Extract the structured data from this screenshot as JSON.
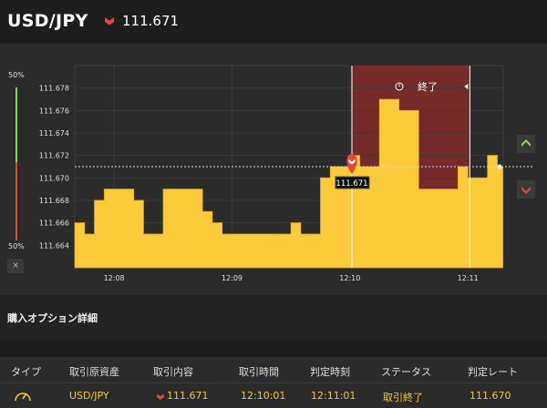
{
  "header": {
    "pair": "USD/JPY",
    "price": "111.671",
    "direction": "down"
  },
  "chart": {
    "percent_top": "50%",
    "percent_bottom": "50%",
    "close_label": "×",
    "end_label": "終了",
    "marker_label": "111.671",
    "y_ticks": [
      "111.678",
      "111.676",
      "111.674",
      "111.672",
      "111.670",
      "111.668",
      "111.666",
      "111.664"
    ],
    "x_ticks": [
      "12:08",
      "12:09",
      "12:10",
      "12:11"
    ],
    "colors": {
      "fill": "#fccb3c",
      "window": "#7a2a2a",
      "down": "#e04a3a",
      "up": "#8fd14f"
    }
  },
  "chart_data": {
    "type": "area",
    "ylim": [
      111.662,
      111.68
    ],
    "x": [
      "12:07:40",
      "12:07:45",
      "12:07:50",
      "12:07:55",
      "12:08:00",
      "12:08:05",
      "12:08:10",
      "12:08:15",
      "12:08:20",
      "12:08:25",
      "12:08:30",
      "12:08:35",
      "12:08:40",
      "12:08:45",
      "12:08:50",
      "12:08:55",
      "12:09:00",
      "12:09:05",
      "12:09:10",
      "12:09:15",
      "12:09:20",
      "12:09:25",
      "12:09:30",
      "12:09:35",
      "12:09:40",
      "12:09:45",
      "12:09:50",
      "12:09:55",
      "12:10:00",
      "12:10:05",
      "12:10:10",
      "12:10:15",
      "12:10:20",
      "12:10:25",
      "12:10:30",
      "12:10:35",
      "12:10:40",
      "12:10:45",
      "12:10:50",
      "12:10:55",
      "12:11:00",
      "12:11:05",
      "12:11:10",
      "12:11:15"
    ],
    "values": [
      111.666,
      111.665,
      111.668,
      111.669,
      111.669,
      111.669,
      111.668,
      111.665,
      111.665,
      111.669,
      111.669,
      111.669,
      111.669,
      111.667,
      111.666,
      111.665,
      111.665,
      111.665,
      111.665,
      111.665,
      111.665,
      111.665,
      111.666,
      111.665,
      111.665,
      111.67,
      111.671,
      111.671,
      111.672,
      111.671,
      111.671,
      111.677,
      111.677,
      111.676,
      111.676,
      111.669,
      111.669,
      111.669,
      111.669,
      111.671,
      111.67,
      111.67,
      111.672,
      111.671
    ],
    "grid": true
  },
  "section": {
    "title": "購入オプション詳細"
  },
  "table": {
    "headers": [
      "タイプ",
      "取引原資産",
      "取引内容",
      "取引時間",
      "判定時刻",
      "ステータス",
      "判定レート"
    ],
    "row": {
      "asset": "USD/JPY",
      "content": "111.671",
      "time": "12:10:01",
      "judge_time": "12:11:01",
      "status": "取引終了",
      "rate": "111.670"
    }
  }
}
